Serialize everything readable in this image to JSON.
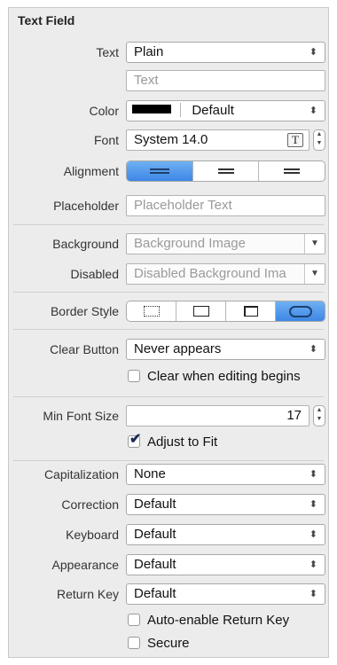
{
  "panel": {
    "title": "Text Field"
  },
  "text": {
    "label": "Text",
    "type_value": "Plain",
    "value_placeholder": "Text"
  },
  "color": {
    "label": "Color",
    "value": "Default",
    "swatch": "#000000"
  },
  "font": {
    "label": "Font",
    "value": "System 14.0",
    "font_picker_glyph": "T"
  },
  "alignment": {
    "label": "Alignment",
    "options": [
      "left",
      "center",
      "right"
    ],
    "selected": "left"
  },
  "placeholder": {
    "label": "Placeholder",
    "value_placeholder": "Placeholder Text"
  },
  "background": {
    "label": "Background",
    "value_placeholder": "Background Image"
  },
  "disabled": {
    "label": "Disabled",
    "value_placeholder": "Disabled Background Ima"
  },
  "border_style": {
    "label": "Border Style",
    "options": [
      "none",
      "line",
      "bezel",
      "rounded"
    ],
    "selected": "rounded"
  },
  "clear_button": {
    "label": "Clear Button",
    "value": "Never appears",
    "clear_when_editing_label": "Clear when editing begins",
    "clear_when_editing_checked": false
  },
  "min_font_size": {
    "label": "Min Font Size",
    "value": "17",
    "adjust_to_fit_label": "Adjust to Fit",
    "adjust_to_fit_checked": true
  },
  "capitalization": {
    "label": "Capitalization",
    "value": "None"
  },
  "correction": {
    "label": "Correction",
    "value": "Default"
  },
  "keyboard": {
    "label": "Keyboard",
    "value": "Default"
  },
  "appearance": {
    "label": "Appearance",
    "value": "Default"
  },
  "return_key": {
    "label": "Return Key",
    "value": "Default",
    "auto_enable_label": "Auto-enable Return Key",
    "auto_enable_checked": false,
    "secure_label": "Secure",
    "secure_checked": false
  },
  "icons": {
    "popup_arrows": "up-down-arrows-icon",
    "dropdown": "triangle-down-icon",
    "checkmark": "checkmark-icon"
  },
  "colors": {
    "selected_segment": "#3d86e6",
    "panel_bg": "#ececec"
  }
}
